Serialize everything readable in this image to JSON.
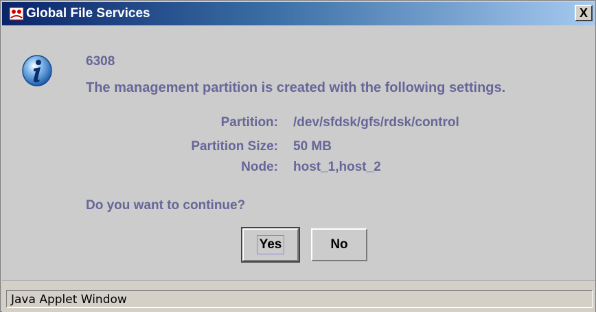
{
  "window": {
    "title": "Global File Services",
    "close_label": "X"
  },
  "icons": {
    "title_icon": "fujitsu-app-icon",
    "message_icon": "info-icon",
    "close_icon": "close-icon"
  },
  "message": {
    "code": "6308",
    "text": "The management partition is created with the following settings.",
    "details": [
      {
        "label": "Partition:",
        "value": "/dev/sfdsk/gfs/rdsk/control"
      },
      {
        "label": "Partition Size:",
        "value": "50 MB"
      },
      {
        "label": "Node:",
        "value": "host_1,host_2"
      }
    ],
    "question": "Do you want to continue?"
  },
  "buttons": {
    "yes_label": "Yes",
    "no_label": "No"
  },
  "status": {
    "text": "Java Applet Window"
  },
  "colors": {
    "title_gradient_start": "#0a246a",
    "title_gradient_end": "#a6caf0",
    "message_text": "#666699",
    "dialog_background": "#cccccc"
  }
}
